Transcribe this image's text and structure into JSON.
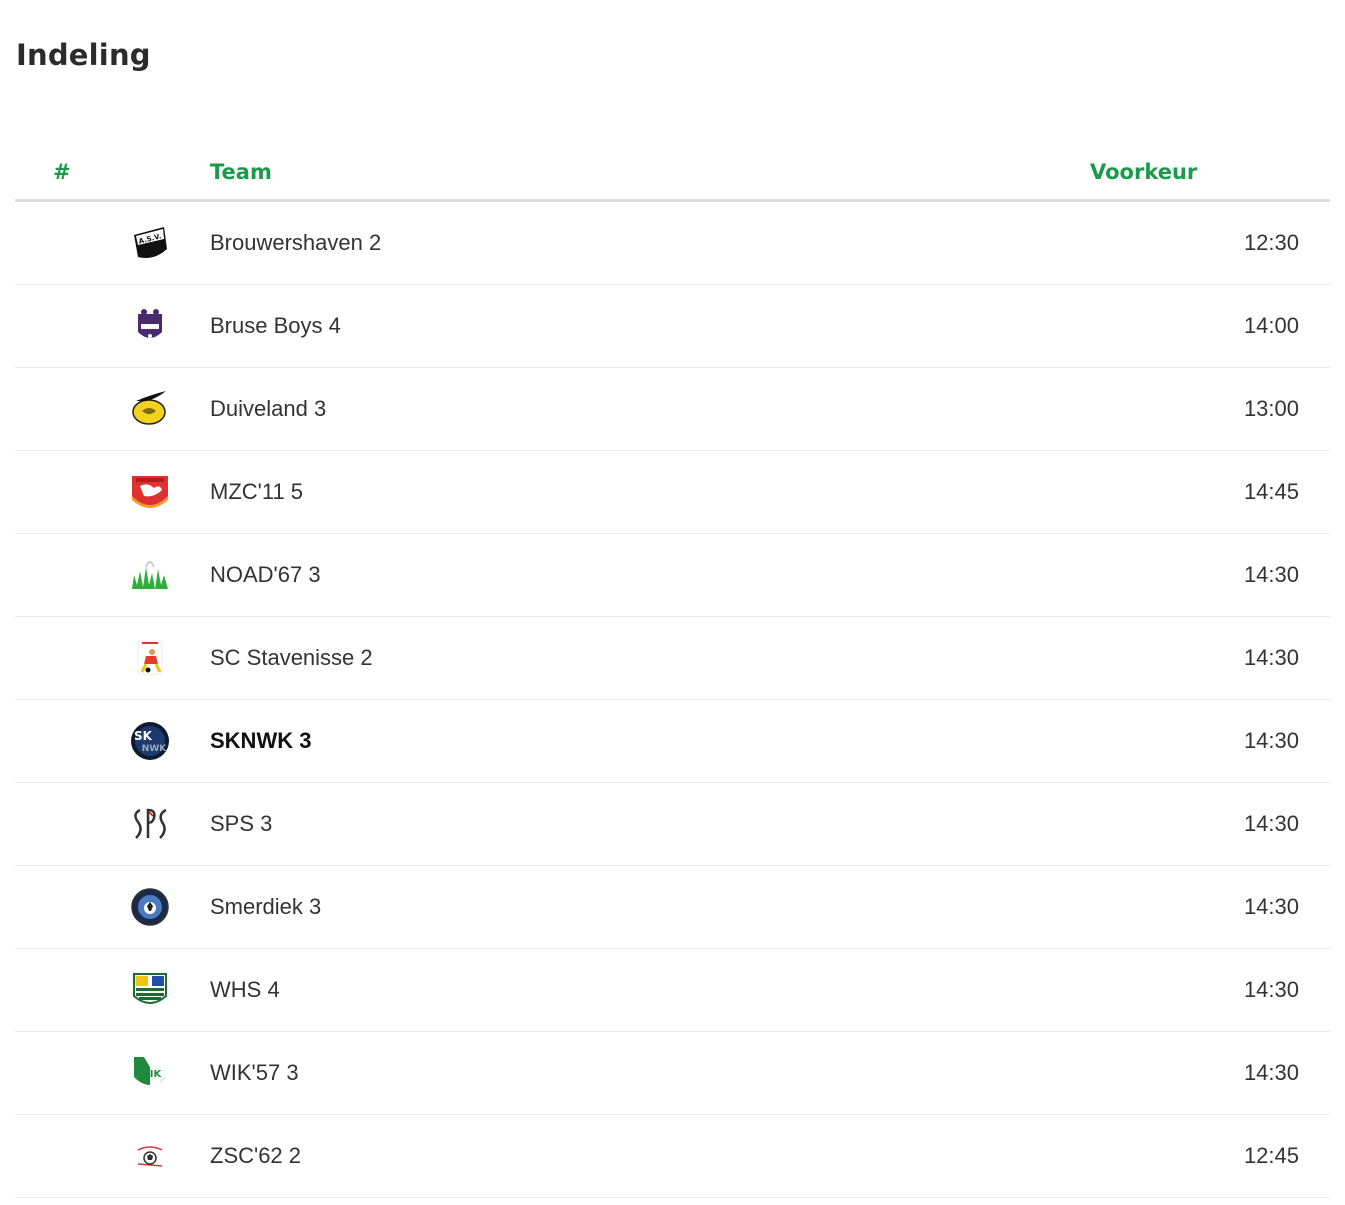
{
  "page": {
    "title": "Indeling"
  },
  "table": {
    "headers": {
      "number": "#",
      "team": "Team",
      "preference": "Voorkeur"
    },
    "rows": [
      {
        "team": "Brouwershaven 2",
        "preference": "12:30",
        "logo_icon": "brouwershaven-logo-icon",
        "highlight": false
      },
      {
        "team": "Bruse Boys 4",
        "preference": "14:00",
        "logo_icon": "bruse-boys-logo-icon",
        "highlight": false
      },
      {
        "team": "Duiveland 3",
        "preference": "13:00",
        "logo_icon": "duiveland-logo-icon",
        "highlight": false
      },
      {
        "team": "MZC'11 5",
        "preference": "14:45",
        "logo_icon": "mzc11-logo-icon",
        "highlight": false
      },
      {
        "team": "NOAD'67 3",
        "preference": "14:30",
        "logo_icon": "noad67-logo-icon",
        "highlight": false
      },
      {
        "team": "SC Stavenisse 2",
        "preference": "14:30",
        "logo_icon": "sc-stavenisse-logo-icon",
        "highlight": false
      },
      {
        "team": "SKNWK 3",
        "preference": "14:30",
        "logo_icon": "sknwk-logo-icon",
        "highlight": true
      },
      {
        "team": "SPS 3",
        "preference": "14:30",
        "logo_icon": "sps-logo-icon",
        "highlight": false
      },
      {
        "team": "Smerdiek 3",
        "preference": "14:30",
        "logo_icon": "smerdiek-logo-icon",
        "highlight": false
      },
      {
        "team": "WHS 4",
        "preference": "14:30",
        "logo_icon": "whs-logo-icon",
        "highlight": false
      },
      {
        "team": "WIK'57 3",
        "preference": "14:30",
        "logo_icon": "wik57-logo-icon",
        "highlight": false
      },
      {
        "team": "ZSC'62 2",
        "preference": "12:45",
        "logo_icon": "zsc62-logo-icon",
        "highlight": false
      }
    ]
  },
  "colors": {
    "accent": "#1a9a4a",
    "text": "#333333",
    "divider": "#e8e8e8",
    "header_rule": "#dcdcdc"
  }
}
